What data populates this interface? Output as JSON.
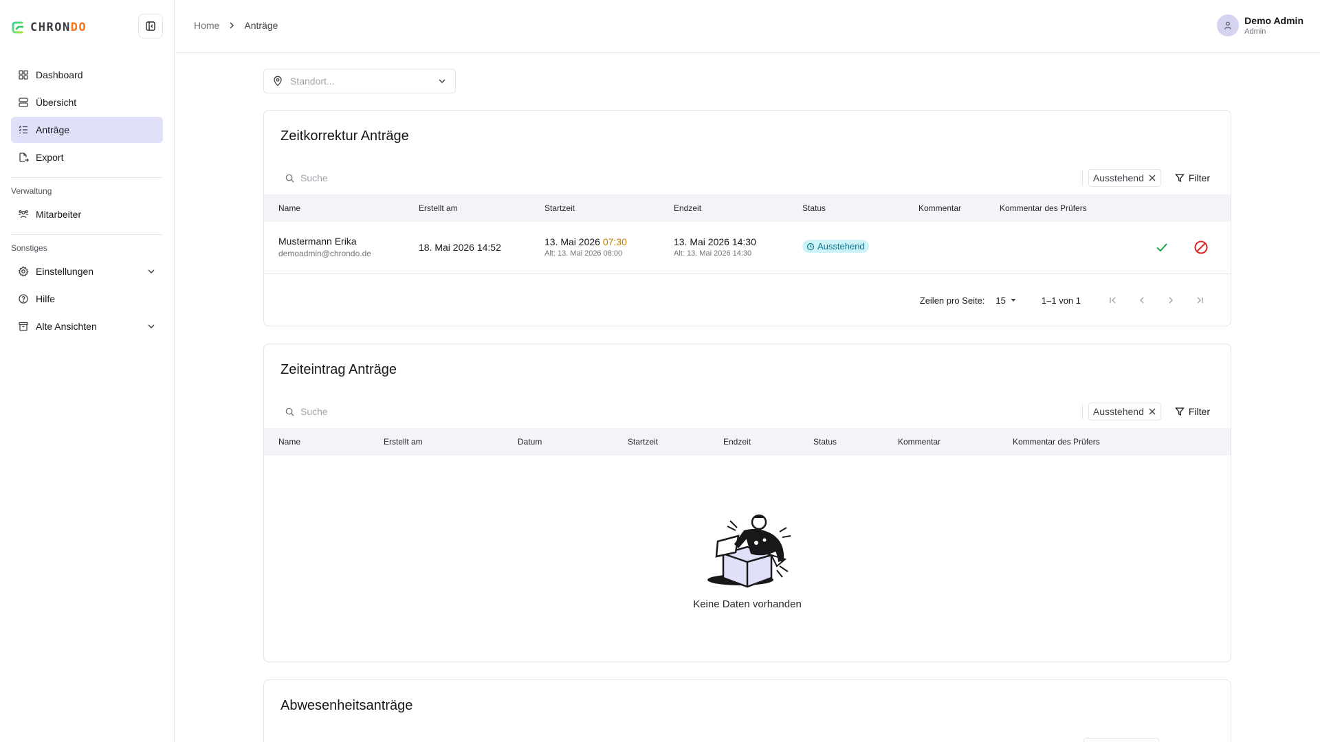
{
  "app": {
    "logo_text_main": "CHRON",
    "logo_text_accent": "DO"
  },
  "sidebar": {
    "items": [
      {
        "label": "Dashboard",
        "icon": "dashboard-icon"
      },
      {
        "label": "Übersicht",
        "icon": "overview-icon"
      },
      {
        "label": "Anträge",
        "icon": "list-check-icon",
        "active": true
      },
      {
        "label": "Export",
        "icon": "file-export-icon"
      }
    ],
    "section_admin": "Verwaltung",
    "admin_items": [
      {
        "label": "Mitarbeiter",
        "icon": "users-icon"
      }
    ],
    "section_misc": "Sonstiges",
    "misc_items": [
      {
        "label": "Einstellungen",
        "icon": "settings-icon",
        "expandable": true
      },
      {
        "label": "Hilfe",
        "icon": "help-icon"
      },
      {
        "label": "Alte Ansichten",
        "icon": "archive-icon",
        "expandable": true
      }
    ]
  },
  "header": {
    "breadcrumb": [
      "Home",
      "Anträge"
    ],
    "user": {
      "name": "Demo Admin",
      "role": "Admin"
    }
  },
  "location": {
    "placeholder": "Standort..."
  },
  "cards": {
    "zeitkorrektur": {
      "title": "Zeitkorrektur Anträge",
      "search_placeholder": "Suche",
      "filter_chip": "Ausstehend",
      "filter_label": "Filter",
      "columns": [
        "Name",
        "Erstellt am",
        "Startzeit",
        "Endzeit",
        "Status",
        "Kommentar",
        "Kommentar des Prüfers"
      ],
      "rows": [
        {
          "name": "Mustermann Erika",
          "email": "demoadmin@chrondo.de",
          "created": "18. Mai 2026 14:52",
          "start_date": "13. Mai 2026",
          "start_time": "07:30",
          "start_old": "Alt: 13. Mai 2026 08:00",
          "end": "13. Mai 2026 14:30",
          "end_old": "Alt: 13. Mai 2026 14:30",
          "status": "Ausstehend"
        }
      ],
      "pagination": {
        "rows_per_page_label": "Zeilen pro Seite:",
        "rows_per_page": "15",
        "range": "1–1 von 1"
      }
    },
    "zeiteintrag": {
      "title": "Zeiteintrag Anträge",
      "search_placeholder": "Suche",
      "filter_chip": "Ausstehend",
      "filter_label": "Filter",
      "columns": [
        "Name",
        "Erstellt am",
        "Datum",
        "Startzeit",
        "Endzeit",
        "Status",
        "Kommentar",
        "Kommentar des Prüfers"
      ],
      "empty_text": "Keine Daten vorhanden"
    },
    "abwesenheit": {
      "title": "Abwesenheitsanträge"
    }
  },
  "colors": {
    "accent_active": "#e0e0f8",
    "status_bg": "#cdf3f8",
    "approve": "#16a34a",
    "reject": "#dc2626",
    "logo_green": "#22c55e",
    "logo_orange": "#f97316"
  }
}
